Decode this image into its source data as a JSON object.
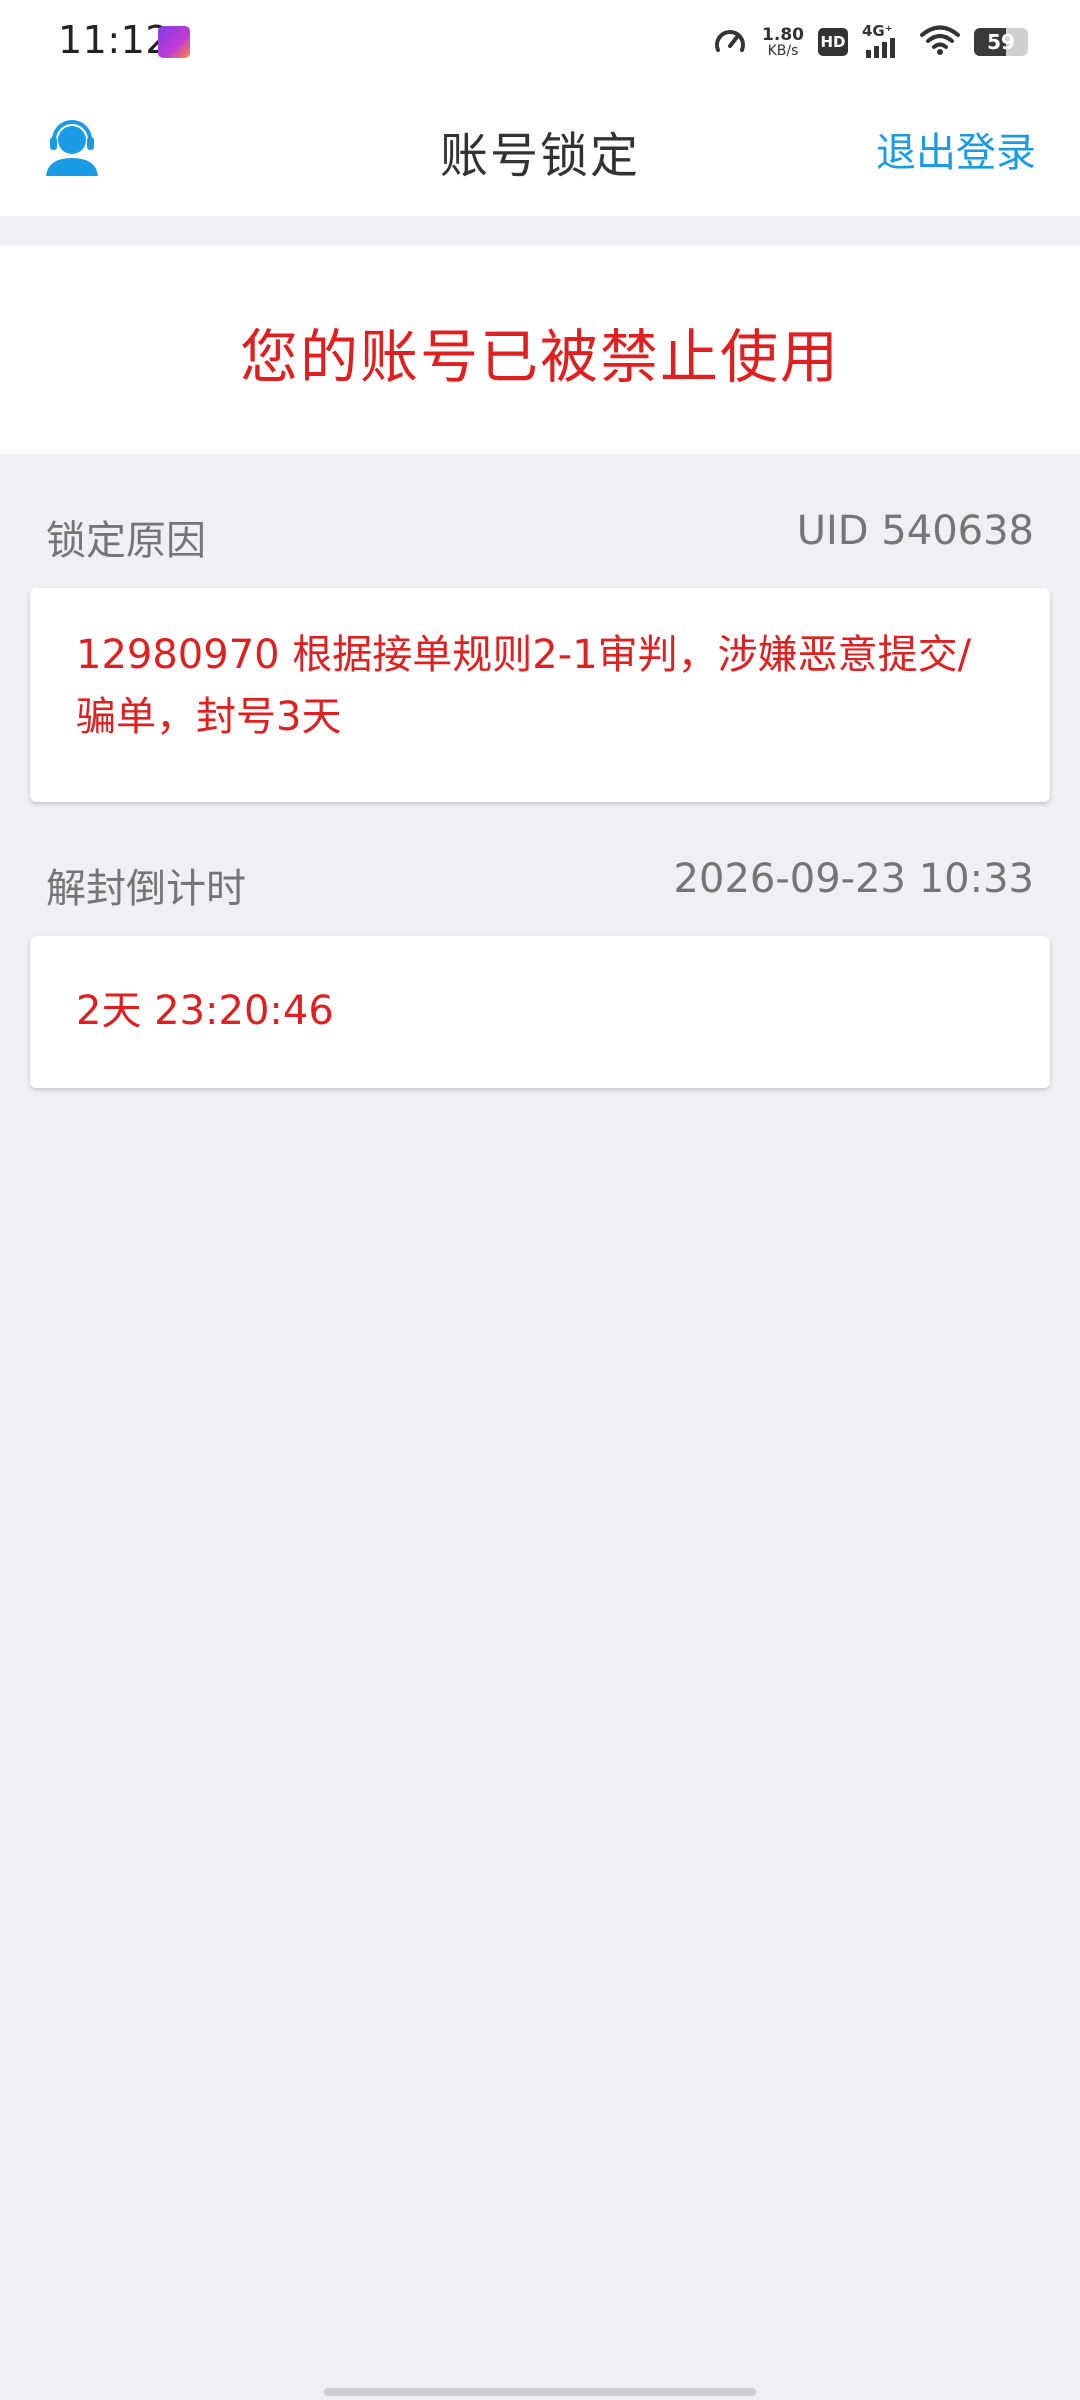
{
  "status_bar": {
    "time": "11:12",
    "net_speed_value": "1.80",
    "net_speed_unit": "KB/s",
    "hd_label": "HD",
    "signal_label": "4G⁺",
    "battery_percent": "59",
    "battery_level": 0.59
  },
  "header": {
    "title": "账号锁定",
    "logout_label": "退出登录",
    "support_icon": "customer-service-icon"
  },
  "banner": {
    "message": "您的账号已被禁止使用"
  },
  "lock_reason": {
    "label": "锁定原因",
    "uid": "UID 540638",
    "text": "12980970 根据接单规则2-1审判，涉嫌恶意提交/骗单，封号3天"
  },
  "countdown": {
    "label": "解封倒计时",
    "unlock_time": "2026-09-23 10:33",
    "remaining": "2天 23:20:46"
  },
  "colors": {
    "accent_blue": "#1a9be6",
    "alert_red": "#e02020",
    "page_background": "#efeff4"
  }
}
